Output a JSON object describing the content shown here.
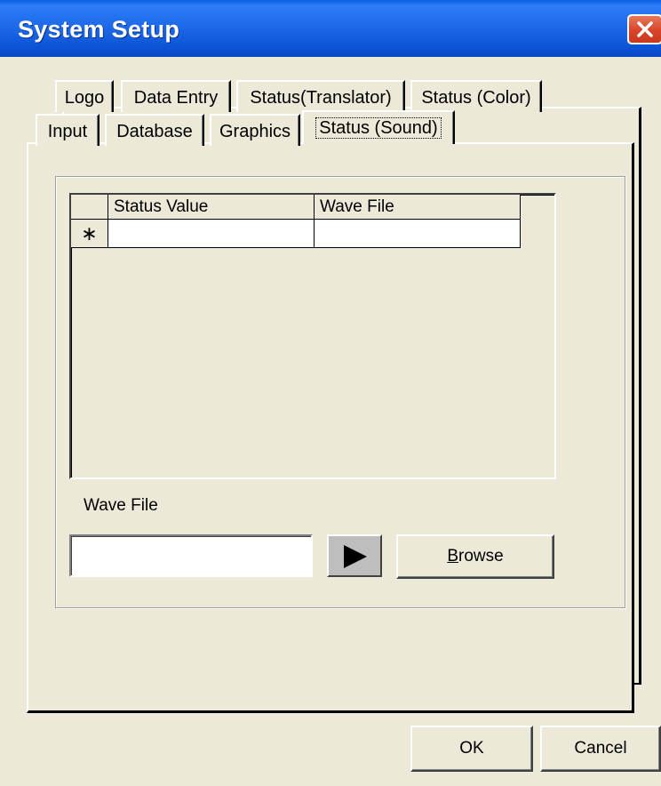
{
  "window": {
    "title": "System Setup"
  },
  "tabs": {
    "row1": [
      "Logo",
      "Data Entry",
      "Status(Translator)",
      "Status (Color)"
    ],
    "row2": [
      "Input",
      "Database",
      "Graphics",
      "Status (Sound)"
    ],
    "active": "Status (Sound)"
  },
  "grid": {
    "columns": [
      "Status Value",
      "Wave File"
    ],
    "rows": [
      {
        "marker": "∗",
        "status_value": "",
        "wave_file": ""
      }
    ]
  },
  "wave_file": {
    "label": "Wave File",
    "value": ""
  },
  "buttons": {
    "browse": "Browse",
    "browse_mnemonic": "B",
    "browse_rest": "rowse",
    "ok": "OK",
    "cancel": "Cancel"
  },
  "icons": {
    "close": "close-icon",
    "play": "play-icon"
  }
}
